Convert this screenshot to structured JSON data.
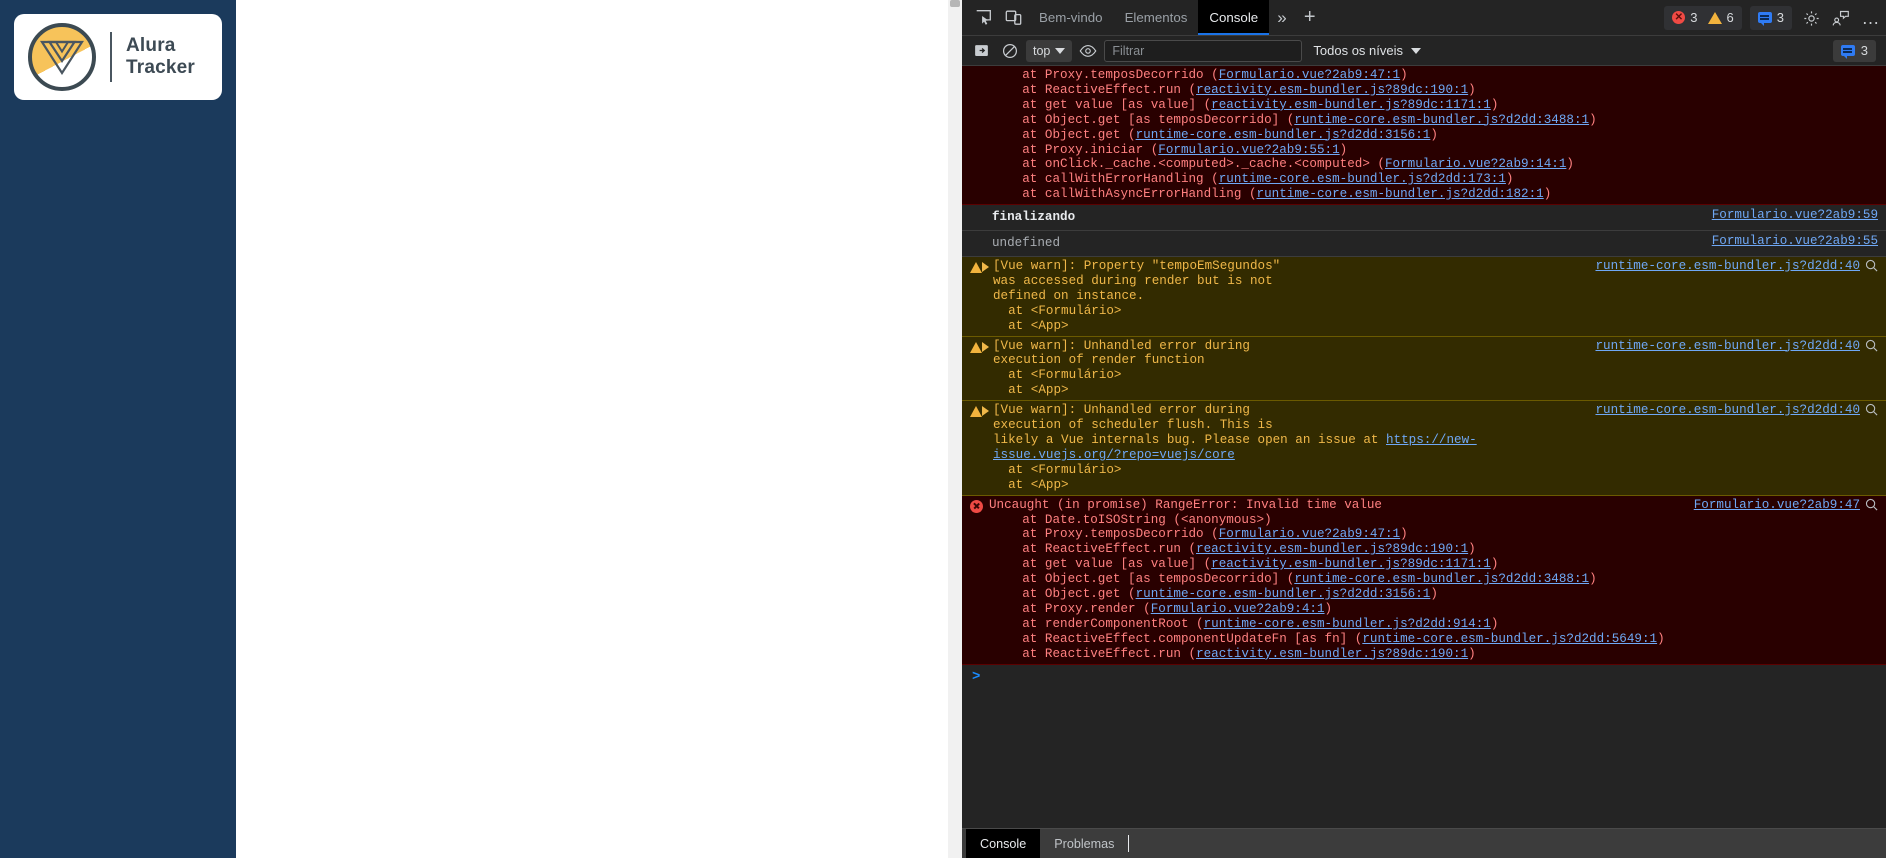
{
  "app": {
    "brand": {
      "line1": "Alura",
      "line2": "Tracker",
      "logo_icon": "vue-logo-icon"
    },
    "sidebar_color": "#1b3a5c"
  },
  "devtools": {
    "tabs": [
      {
        "label": "Bem-vindo",
        "selected": false
      },
      {
        "label": "Elementos",
        "selected": false
      },
      {
        "label": "Console",
        "selected": true
      }
    ],
    "tab_more": "»",
    "tab_plus": "+",
    "counters": {
      "errors": "3",
      "warnings": "6",
      "messages": "3"
    },
    "icons": {
      "inspect": "inspect-element-icon",
      "device": "device-toolbar-icon",
      "settings": "gear-icon",
      "feedback": "feedback-icon",
      "more": "…"
    },
    "filterbar": {
      "sidebar_toggle": "console-sidebar-icon",
      "clear": "clear-console-icon",
      "context": "top",
      "eye": "live-expression-icon",
      "filter_placeholder": "Filtrar",
      "filter_value": "",
      "levels": "Todos os níveis",
      "message_count": "3"
    },
    "console": {
      "entries": [
        {
          "kind": "error-stack-continuation",
          "lines": [
            "    at Proxy.temposDecorrido (Formulario.vue?2ab9:47:1)",
            "    at ReactiveEffect.run (reactivity.esm-bundler.js?89dc:190:1)",
            "    at get value [as value] (reactivity.esm-bundler.js?89dc:1171:1)",
            "    at Object.get [as temposDecorrido] (runtime-core.esm-bundler.js?d2dd:3488:1)",
            "    at Object.get (runtime-core.esm-bundler.js?d2dd:3156:1)",
            "    at Proxy.iniciar (Formulario.vue?2ab9:55:1)",
            "    at onClick._cache.<computed>._cache.<computed> (Formulario.vue?2ab9:14:1)",
            "    at callWithErrorHandling (runtime-core.esm-bundler.js?d2dd:173:1)",
            "    at callWithAsyncErrorHandling (runtime-core.esm-bundler.js?d2dd:182:1)"
          ]
        },
        {
          "kind": "log",
          "text": "finalizando",
          "link": "Formulario.vue?2ab9:59"
        },
        {
          "kind": "log-dim",
          "text": "undefined",
          "link": "Formulario.vue?2ab9:55"
        },
        {
          "kind": "warn",
          "head": "[Vue warn]: Property \"tempoEmSegundos\"",
          "body": "was accessed during render but is not\ndefined on instance.",
          "stack": "  at <Formulário>\n  at <App>",
          "link": "runtime-core.esm-bundler.js?d2dd:40"
        },
        {
          "kind": "warn",
          "head": "[Vue warn]: Unhandled error during",
          "body": "execution of render function",
          "stack": "  at <Formulário>\n  at <App>",
          "link": "runtime-core.esm-bundler.js?d2dd:40"
        },
        {
          "kind": "warn-url",
          "head": "[Vue warn]: Unhandled error during",
          "body_pre": "execution of scheduler flush. This is\nlikely a Vue internals bug. Please open an issue at ",
          "url": "https://new-issue.vuejs.org/?repo=vuejs/core",
          "stack": "  at <Formulário>\n  at <App>",
          "link": "runtime-core.esm-bundler.js?d2dd:40"
        },
        {
          "kind": "error",
          "head": "Uncaught (in promise) RangeError: Invalid time value",
          "link": "Formulario.vue?2ab9:47",
          "lines": [
            "    at Date.toISOString (<anonymous>)",
            "    at Proxy.temposDecorrido (Formulario.vue?2ab9:47:1)",
            "    at ReactiveEffect.run (reactivity.esm-bundler.js?89dc:190:1)",
            "    at get value [as value] (reactivity.esm-bundler.js?89dc:1171:1)",
            "    at Object.get [as temposDecorrido] (runtime-core.esm-bundler.js?d2dd:3488:1)",
            "    at Object.get (runtime-core.esm-bundler.js?d2dd:3156:1)",
            "    at Proxy.render (Formulario.vue?2ab9:4:1)",
            "    at renderComponentRoot (runtime-core.esm-bundler.js?d2dd:914:1)",
            "    at ReactiveEffect.componentUpdateFn [as fn] (runtime-core.esm-bundler.js?d2dd:5649:1)",
            "    at ReactiveEffect.run (reactivity.esm-bundler.js?89dc:190:1)"
          ]
        }
      ],
      "prompt": ">"
    },
    "drawer": {
      "tabs": [
        {
          "label": "Console",
          "on": true
        },
        {
          "label": "Problemas",
          "on": false
        }
      ]
    }
  }
}
